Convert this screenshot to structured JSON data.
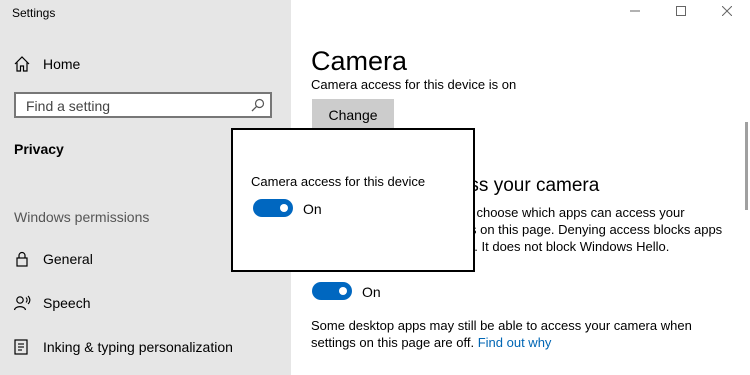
{
  "app": {
    "title": "Settings"
  },
  "sidebar": {
    "home_label": "Home",
    "search_placeholder": "Find a setting",
    "category_title": "Privacy",
    "section_heading": "Windows permissions",
    "items": [
      {
        "label": "General",
        "icon": "lock-icon"
      },
      {
        "label": "Speech",
        "icon": "speech-icon"
      },
      {
        "label": "Inking & typing personalization",
        "icon": "inking-icon"
      }
    ]
  },
  "main": {
    "title": "Camera",
    "device_status": "Camera access for this device is on",
    "change_label": "Change",
    "allow_heading": "Allow apps to access your camera",
    "allow_description": "If you allow access, you can choose which apps can access your camera by using the settings on this page. Denying access blocks apps from accessing your camera. It does not block Windows Hello.",
    "toggle_label": "On",
    "footnote": "Some desktop apps may still be able to access your camera when settings on this page are off.",
    "footnote_link": "Find out why"
  },
  "dialog": {
    "title": "Camera access for this device",
    "toggle_label": "On"
  },
  "colors": {
    "accent": "#0067c0",
    "sidebar_bg": "#e6e6e6",
    "link": "#0066b4",
    "button_bg": "#cccccc"
  }
}
